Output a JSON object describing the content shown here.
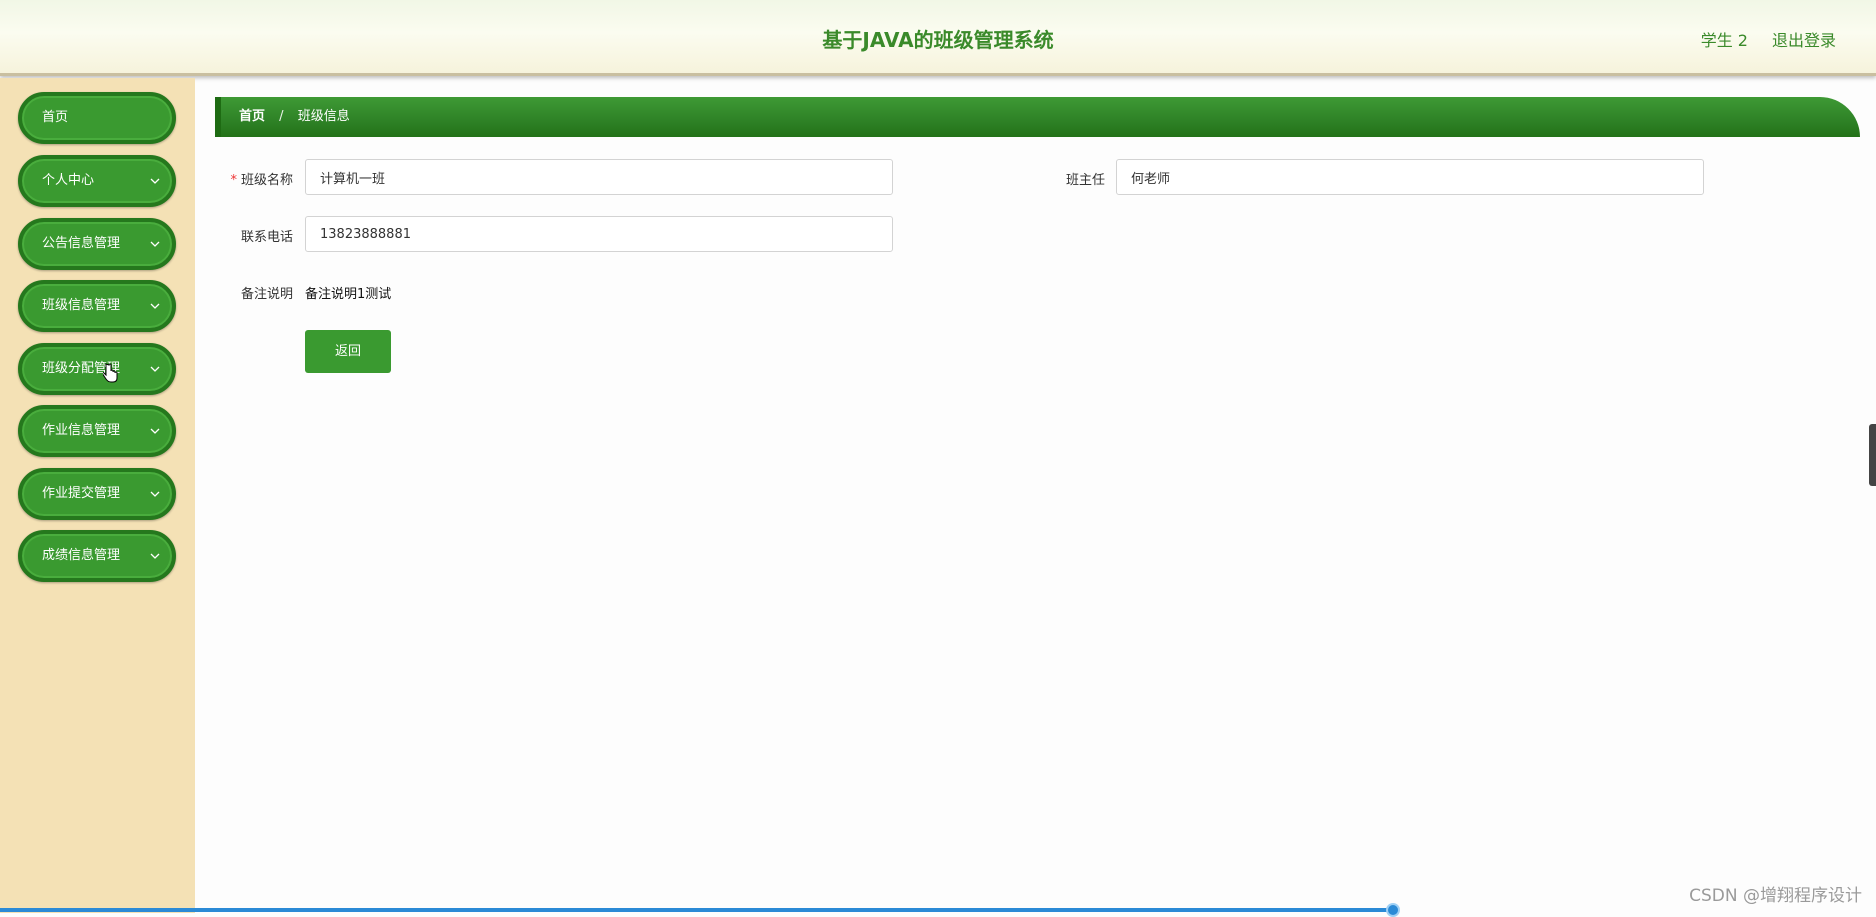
{
  "header": {
    "title": "基于JAVA的班级管理系统",
    "user": "学生 2",
    "logout": "退出登录"
  },
  "sidebar": {
    "items": [
      {
        "label": "首页"
      },
      {
        "label": "个人中心"
      },
      {
        "label": "公告信息管理"
      },
      {
        "label": "班级信息管理"
      },
      {
        "label": "班级分配管理"
      },
      {
        "label": "作业信息管理"
      },
      {
        "label": "作业提交管理"
      },
      {
        "label": "成绩信息管理"
      }
    ]
  },
  "breadcrumb": {
    "home": "首页",
    "separator": "/",
    "current": "班级信息"
  },
  "form": {
    "class_name_label": "班级名称",
    "class_name_value": "计算机一班",
    "head_teacher_label": "班主任",
    "head_teacher_value": "何老师",
    "phone_label": "联系电话",
    "phone_value": "13823888881",
    "remark_label": "备注说明",
    "remark_value": "备注说明1测试",
    "back_button": "返回"
  },
  "watermark": "CSDN @增翔程序设计",
  "colors": {
    "primary_green": "#3a9a30",
    "dark_green": "#25781d",
    "sidebar_bg": "#f4e1b5",
    "accent_text": "#3a8a2a"
  }
}
